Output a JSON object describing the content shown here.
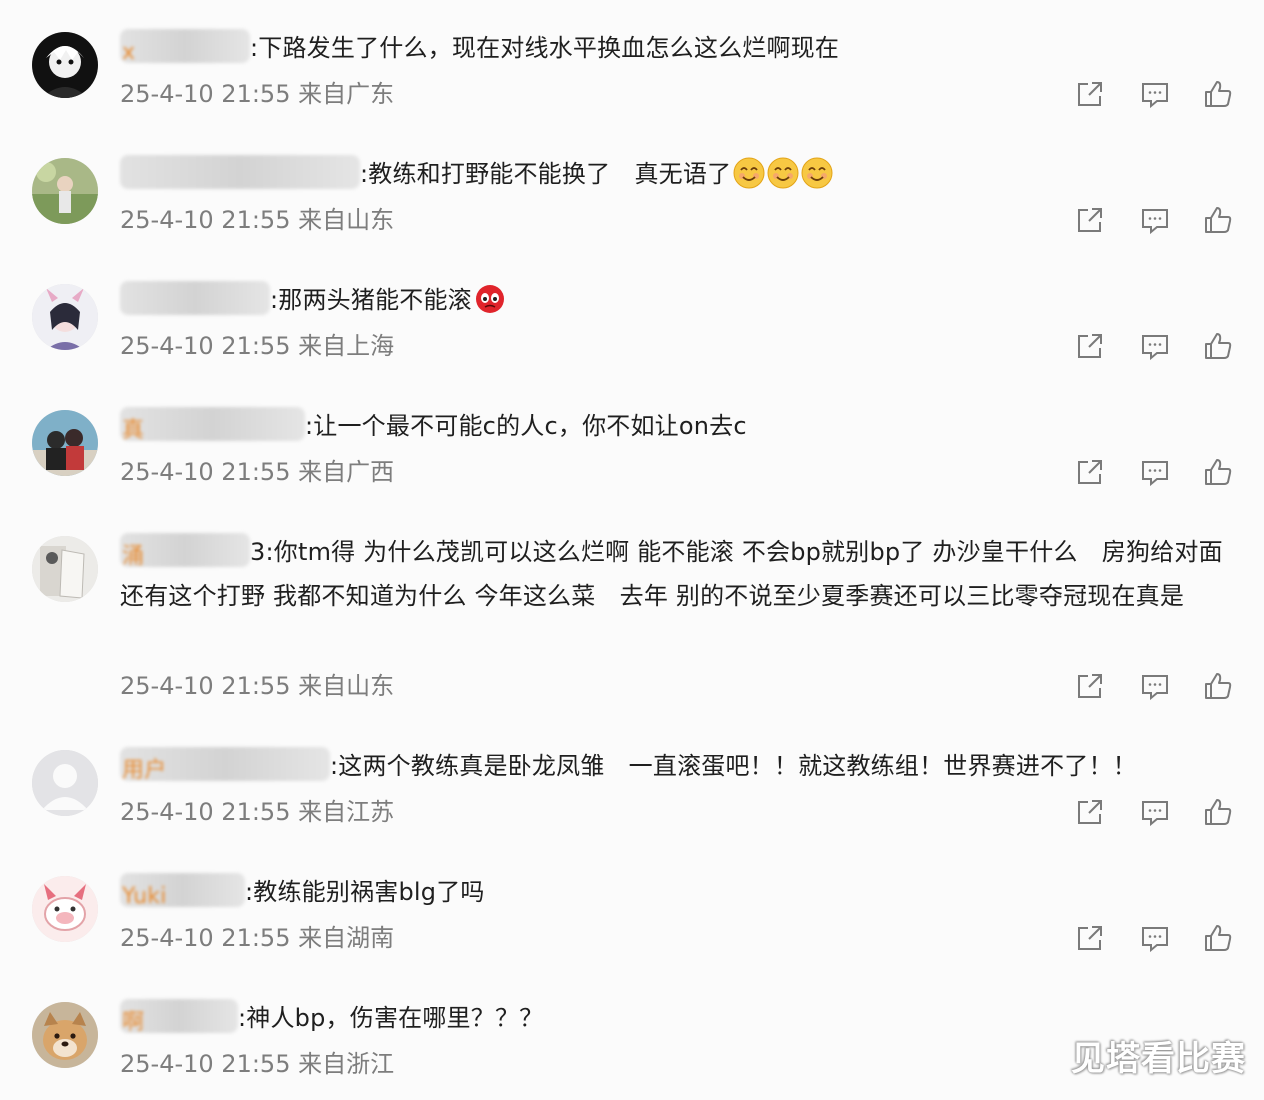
{
  "comments": [
    {
      "username": "x",
      "username_color": "#e88a2e",
      "text": ":下路发生了什么，现在对线水平换血怎么这么烂啊现在",
      "emojis": [],
      "time": "25-4-10 21:55",
      "location": "来自广东"
    },
    {
      "username": "",
      "username_color": "#e88a2e",
      "text": ":教练和打野能不能换了　真无语了",
      "emojis": [
        "smile-emoji",
        "smile-emoji",
        "smile-emoji"
      ],
      "time": "25-4-10 21:55",
      "location": "来自山东"
    },
    {
      "username": "",
      "username_color": "#e88a2e",
      "text": ":那两头猪能不能滚",
      "emojis": [
        "angry-emoji"
      ],
      "time": "25-4-10 21:55",
      "location": "来自上海"
    },
    {
      "username": "真",
      "username_color": "#e88a2e",
      "text": ":让一个最不可能c的人c，你不如让on去c",
      "emojis": [],
      "time": "25-4-10 21:55",
      "location": "来自广西"
    },
    {
      "username": "涌",
      "username_color": "#e88a2e",
      "text": "3:你tm得 为什么茂凯可以这么烂啊 能不能滚 不会bp就别bp了 办沙皇干什么　房狗给对面　还有这个打野 我都不知道为什么 今年这么菜　去年 别的不说至少夏季赛还可以三比零夺冠现在真是",
      "emojis": [],
      "time": "25-4-10 21:55",
      "location": "来自山东"
    },
    {
      "username": "用户",
      "username_color": "#e88a2e",
      "text": ":这两个教练真是卧龙凤雏　一直滚蛋吧！！就这教练组！世界赛进不了！！",
      "emojis": [],
      "time": "25-4-10 21:55",
      "location": "来自江苏"
    },
    {
      "username": "Yuki",
      "username_color": "#e88a2e",
      "text": ":教练能别祸害blg了吗",
      "emojis": [],
      "time": "25-4-10 21:55",
      "location": "来自湖南"
    },
    {
      "username": "啊",
      "username_color": "#e88a2e",
      "text": ":神人bp，伤害在哪里？？？",
      "emojis": [],
      "time": "25-4-10 21:55",
      "location": "来自浙江"
    }
  ],
  "watermark": "见塔看比赛",
  "colors": {
    "text": "#1f1f1f",
    "meta": "#7d7d7d",
    "icon": "#7a7a7a",
    "background": "#fbfbfb"
  }
}
